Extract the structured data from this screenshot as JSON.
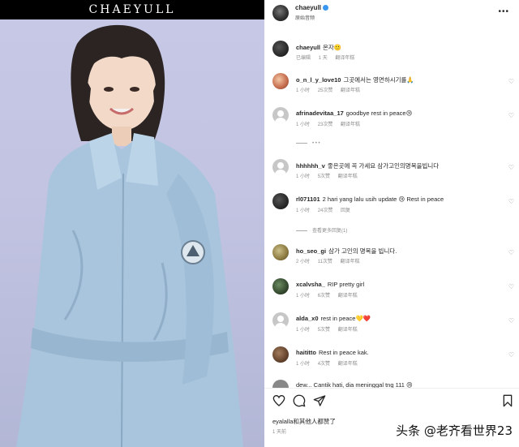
{
  "photo": {
    "brand": "CHAEYULL"
  },
  "post": {
    "username": "chaeyull",
    "subtitle": "原始音频",
    "more_icon": "more-horizontal-icon",
    "verified_color": "#3897f0"
  },
  "comments": [
    {
      "user": "chaeyull",
      "text": "온자🙂",
      "time": "已编辑",
      "likes": "1 天",
      "reply": "翻译年糕"
    },
    {
      "user": "o_n_l_y_love10",
      "text": "그곳에서는 영면하시기를🙏",
      "time": "1 小时",
      "likes": "25次赞",
      "reply": "翻译年糕"
    },
    {
      "user": "afrinadevitaa_17",
      "text": "goodbye rest in peace😢",
      "time": "1 小时",
      "likes": "23次赞",
      "reply": "翻译年糕"
    },
    {
      "user": "hhhhhh_v",
      "text": "좋은곳에 꼭 가세요 삼가고인의명복을빕니다",
      "time": "1 小时",
      "likes": "5次赞",
      "reply": "翻译年糕"
    },
    {
      "user": "rl071101",
      "text": "2 hari yang lalu usih update 😢 Rest in peace",
      "time": "1 小时",
      "likes": "24次赞",
      "reply": "回复"
    },
    {
      "user": "ho_seo_gi",
      "text": "삼가 고인의 명복을 빕니다.",
      "time": "2 小时",
      "likes": "11次赞",
      "reply": "翻译年糕"
    },
    {
      "user": "xcalvsha_",
      "text": "RIP pretty girl",
      "time": "1 小时",
      "likes": "6次赞",
      "reply": "翻译年糕"
    },
    {
      "user": "alda_x0",
      "text": "rest in peace💛❤️",
      "time": "1 小时",
      "likes": "5次赞",
      "reply": "翻译年糕"
    },
    {
      "user": "haititto",
      "text": "Rest in peace kak.",
      "time": "1 小时",
      "likes": "4次赞",
      "reply": "翻译年糕"
    }
  ],
  "partial_comment": "dew...   Cantik hati, dia meninggal tng 111 😢",
  "view_replies": "查看更多回复(1)",
  "actions": {
    "like": "heart-outline-icon",
    "comment": "comment-bubble-icon",
    "share": "paper-plane-icon",
    "save": "bookmark-icon"
  },
  "likes_line": "eyalalla和其他人都赞了",
  "time_line": "1 天前",
  "watermark": "头条 @老齐看世界23"
}
